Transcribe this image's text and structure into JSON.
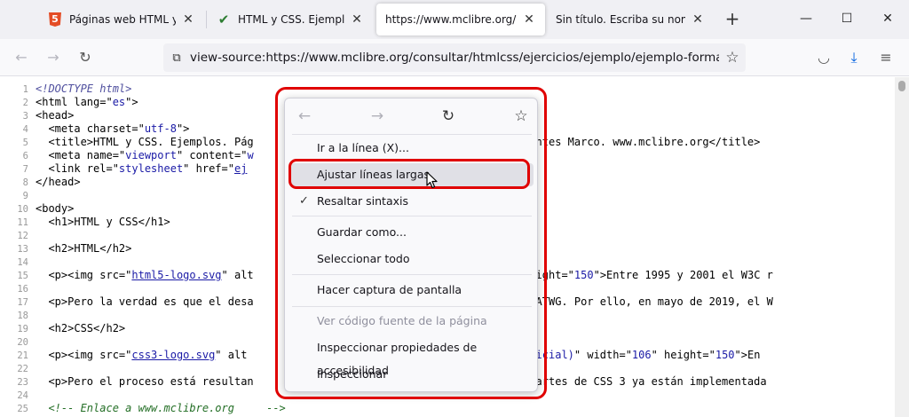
{
  "tabs": [
    {
      "title": "Páginas web HTML y hoja",
      "icon": "html5-icon",
      "active": false
    },
    {
      "title": "HTML y CSS. Ejemplos. P",
      "icon": "checkmark-icon",
      "active": false
    },
    {
      "title": "https://www.mclibre.org/co",
      "icon": "",
      "active": true
    },
    {
      "title": "Sin título. Escriba su nombre.",
      "icon": "",
      "active": false
    }
  ],
  "tab_close_glyph": "✕",
  "new_tab_glyph": "+",
  "window_controls": {
    "minimize": "—",
    "maximize": "☐",
    "close": "✕"
  },
  "nav": {
    "back": "←",
    "forward": "→",
    "reload": "↻",
    "url": "view-source:https://www.mclibre.org/consultar/htmlcss/ejercicios/ejemplo/ejemplo-formateado.ht",
    "page_icon": "⧉",
    "star": "☆",
    "pocket": "◡",
    "downloads": "⤓",
    "menu": "≡"
  },
  "source_lines": [
    {
      "n": "1",
      "html": "<span class=\"c-doctype\">&lt;!DOCTYPE html&gt;</span>"
    },
    {
      "n": "2",
      "html": "&lt;html lang=\"<span class=\"c-val\">es</span>\"&gt;"
    },
    {
      "n": "3",
      "html": "&lt;head&gt;"
    },
    {
      "n": "4",
      "html": "  &lt;meta charset=\"<span class=\"c-val\">utf-8</span>\"&gt;"
    },
    {
      "n": "5",
      "html": "  &lt;title&gt;HTML y CSS. Ejemplos. Pág                                Bartolomé Sintes Marco. www.mclibre.org&lt;/title&gt;"
    },
    {
      "n": "6",
      "html": "  &lt;meta name=\"<span class=\"c-val\">viewport</span>\" content=\"<span class=\"c-val\">w</span>                                   \"&gt;"
    },
    {
      "n": "7",
      "html": "  &lt;link rel=\"<span class=\"c-val\">stylesheet</span>\" href=\"<span class=\"c-link\">ej</span>"
    },
    {
      "n": "8",
      "html": "&lt;/head&gt;"
    },
    {
      "n": "9",
      "html": ""
    },
    {
      "n": "10",
      "html": "&lt;body&gt;"
    },
    {
      "n": "11",
      "html": "  &lt;h1&gt;HTML y CSS&lt;/h1&gt;"
    },
    {
      "n": "12",
      "html": ""
    },
    {
      "n": "13",
      "html": "  &lt;h2&gt;HTML&lt;/h2&gt;"
    },
    {
      "n": "14",
      "html": ""
    },
    {
      "n": "15",
      "html": "  &lt;p&gt;&lt;img src=\"<span class=\"c-link\">html5-logo.svg</span>\" alt                              width=\"<span class=\"c-val\">106</span>\" height=\"<span class=\"c-val\">150</span>\"&gt;Entre 1995 y 2001 el W3C r"
    },
    {
      "n": "16",
      "html": ""
    },
    {
      "n": "17",
      "html": "  &lt;p&gt;Pero la verdad es que el desa                              lucía en el WHATWG. Por ello, en mayo de 2019, el W"
    },
    {
      "n": "18",
      "html": ""
    },
    {
      "n": "19",
      "html": "  &lt;h2&gt;CSS&lt;/h2&gt;"
    },
    {
      "n": "20",
      "html": ""
    },
    {
      "n": "21",
      "html": "  &lt;p&gt;&lt;img src=\"<span class=\"c-link\">css3-logo.svg</span>\" alt                              <span class=\"c-val\">ro CSS 3 (no oficial)</span>\" width=\"<span class=\"c-val\">106</span>\" height=\"<span class=\"c-val\">150</span>\"&gt;En"
    },
    {
      "n": "22",
      "html": ""
    },
    {
      "n": "23",
      "html": "  &lt;p&gt;Pero el proceso está resultan                              sólo algunas partes de CSS 3 ya están implementada"
    },
    {
      "n": "24",
      "html": ""
    },
    {
      "n": "25",
      "html": "  <span class=\"c-comment\">&lt;!-- Enlace a www.mclibre.org     --&gt;</span>"
    }
  ],
  "context_menu": {
    "back": "←",
    "forward": "→",
    "reload": "↻",
    "bookmark": "☆",
    "items": [
      {
        "label": "Ir a la línea (X)...",
        "checked": false,
        "disabled": false,
        "hover": false
      },
      {
        "label": "Ajustar líneas largas",
        "checked": false,
        "disabled": false,
        "hover": true
      },
      {
        "label": "Resaltar sintaxis",
        "checked": true,
        "disabled": false,
        "hover": false
      },
      {
        "label": "Guardar como...",
        "checked": false,
        "disabled": false,
        "hover": false
      },
      {
        "label": "Seleccionar todo",
        "checked": false,
        "disabled": false,
        "hover": false
      },
      {
        "label": "Hacer captura de pantalla",
        "checked": false,
        "disabled": false,
        "hover": false
      },
      {
        "label": "Ver código fuente de la página",
        "checked": false,
        "disabled": true,
        "hover": false
      },
      {
        "label": "Inspeccionar propiedades de accesibilidad",
        "checked": false,
        "disabled": false,
        "hover": false
      },
      {
        "label": "Inspeccionar",
        "checked": false,
        "disabled": false,
        "hover": false
      }
    ],
    "check_glyph": "✓"
  },
  "highlight_color": "#e00000"
}
